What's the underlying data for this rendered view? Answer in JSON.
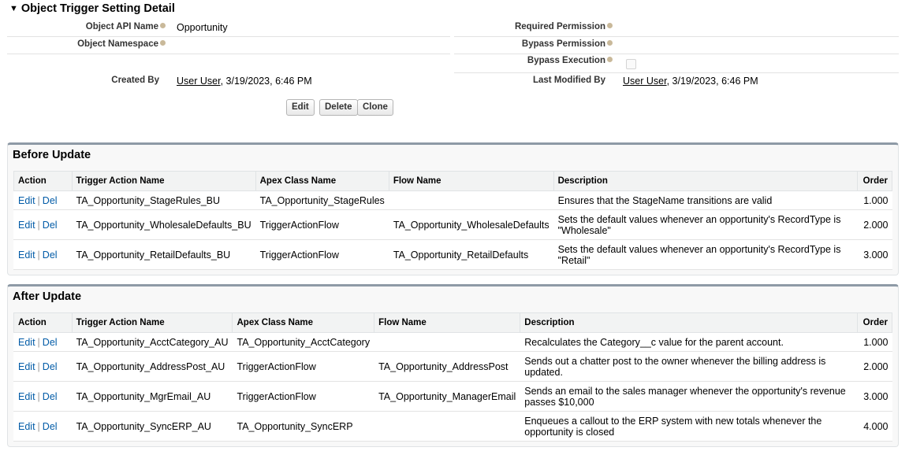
{
  "header": {
    "title": "Object Trigger Setting Detail"
  },
  "detail": {
    "object_api_name_label": "Object API Name",
    "object_api_name": "Opportunity",
    "object_namespace_label": "Object Namespace",
    "required_permission_label": "Required Permission",
    "bypass_permission_label": "Bypass Permission",
    "bypass_execution_label": "Bypass Execution",
    "bypass_execution_checked": false,
    "created_by_label": "Created By",
    "created_by_user": "User User",
    "created_by_date": ", 3/19/2023, 6:46 PM",
    "last_modified_by_label": "Last Modified By",
    "last_modified_user": "User User",
    "last_modified_date": ", 3/19/2023, 6:46 PM"
  },
  "buttons": {
    "edit": "Edit",
    "delete": "Delete",
    "clone": "Clone"
  },
  "before_update": {
    "title": "Before Update",
    "columns": [
      "Action",
      "Trigger Action Name",
      "Apex Class Name",
      "Flow Name",
      "Description",
      "Order"
    ],
    "rows": [
      {
        "edit": "Edit",
        "sep": "|",
        "del": "Del",
        "name": "TA_Opportunity_StageRules_BU",
        "apex": "TA_Opportunity_StageRules",
        "flow": "",
        "desc1": "Ensures that the StageName transitions are valid",
        "desc2": "",
        "order": "1.000"
      },
      {
        "edit": "Edit",
        "sep": "|",
        "del": "Del",
        "name": "TA_Opportunity_WholesaleDefaults_BU",
        "apex": "TriggerActionFlow",
        "flow": "TA_Opportunity_WholesaleDefaults",
        "desc1": "Sets the default values whenever an opportunity's RecordType is",
        "desc2": "\"Wholesale\"",
        "order": "2.000"
      },
      {
        "edit": "Edit",
        "sep": "|",
        "del": "Del",
        "name": "TA_Opportunity_RetailDefaults_BU",
        "apex": "TriggerActionFlow",
        "flow": "TA_Opportunity_RetailDefaults",
        "desc1": "Sets the default values whenever an opportunity's RecordType is",
        "desc2": "\"Retail\"",
        "order": "3.000"
      }
    ]
  },
  "after_update": {
    "title": "After Update",
    "columns": [
      "Action",
      "Trigger Action Name",
      "Apex Class Name",
      "Flow Name",
      "Description",
      "Order"
    ],
    "rows": [
      {
        "edit": "Edit",
        "sep": "|",
        "del": "Del",
        "name": "TA_Opportunity_AcctCategory_AU",
        "apex": "TA_Opportunity_AcctCategory",
        "flow": "",
        "desc1": "Recalculates the Category__c value for the parent account.",
        "desc2": "",
        "order": "1.000"
      },
      {
        "edit": "Edit",
        "sep": "|",
        "del": "Del",
        "name": "TA_Opportunity_AddressPost_AU",
        "apex": "TriggerActionFlow",
        "flow": "TA_Opportunity_AddressPost",
        "desc1": "Sends out a chatter post to the owner whenever the billing address is",
        "desc2": "updated.",
        "order": "2.000"
      },
      {
        "edit": "Edit",
        "sep": "|",
        "del": "Del",
        "name": "TA_Opportunity_MgrEmail_AU",
        "apex": "TriggerActionFlow",
        "flow": "TA_Opportunity_ManagerEmail",
        "desc1": "Sends an email to the sales manager whenever the opportunity's revenue",
        "desc2": "passes $10,000",
        "order": "3.000"
      },
      {
        "edit": "Edit",
        "sep": "|",
        "del": "Del",
        "name": "TA_Opportunity_SyncERP_AU",
        "apex": "TA_Opportunity_SyncERP",
        "flow": "",
        "desc1": "Enqueues a callout to the ERP system with new totals whenever the",
        "desc2": "opportunity is closed",
        "order": "4.000"
      }
    ]
  }
}
